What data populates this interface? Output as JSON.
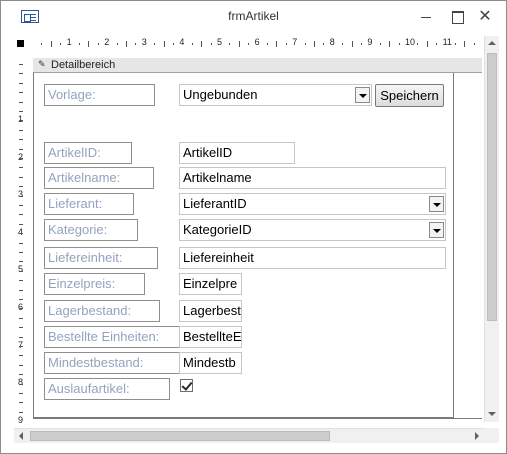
{
  "window": {
    "title": "frmArtikel",
    "close_glyph": "✕"
  },
  "ruler": {
    "origin_icon": "ruler-origin-square",
    "labels": [
      "1",
      "2",
      "3",
      "4",
      "5",
      "6",
      "7",
      "8",
      "9",
      "10",
      "11"
    ],
    "vertical_labels": [
      "1",
      "2",
      "3",
      "4",
      "5",
      "6",
      "7",
      "8",
      "9"
    ]
  },
  "section": {
    "icon": "pin-icon",
    "glyph": "✎",
    "title": "Detailbereich"
  },
  "form": {
    "vorlage": {
      "label": "Vorlage:",
      "value": "Ungebunden"
    },
    "save_button": "Speichern",
    "fields": [
      {
        "label": "ArtikelID:",
        "value": "ArtikelID",
        "type": "text"
      },
      {
        "label": "Artikelname:",
        "value": "Artikelname",
        "type": "text"
      },
      {
        "label": "Lieferant:",
        "value": "LieferantID",
        "type": "combo"
      },
      {
        "label": "Kategorie:",
        "value": "KategorieID",
        "type": "combo"
      },
      {
        "label": "Liefereinheit:",
        "value": "Liefereinheit",
        "type": "text"
      },
      {
        "label": "Einzelpreis:",
        "value": "Einzelpre",
        "type": "text"
      },
      {
        "label": "Lagerbestand:",
        "value": "Lagerbest",
        "type": "text"
      },
      {
        "label": "Bestellte Einheiten:",
        "value": "BestellteE",
        "type": "text"
      },
      {
        "label": "Mindestbestand:",
        "value": "Mindestb",
        "type": "text"
      },
      {
        "label": "Auslaufartikel:",
        "checked": true,
        "type": "checkbox"
      }
    ]
  }
}
